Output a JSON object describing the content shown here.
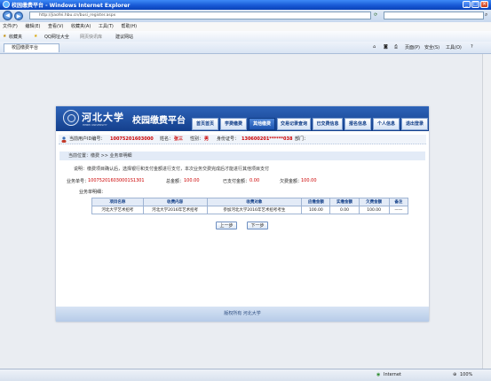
{
  "window": {
    "title": "校园缴费平台 - Windows Internet Explorer",
    "minimize": "_",
    "maximize": "□",
    "close": "×"
  },
  "address": {
    "url": "http://jiaofei.hbu.cn/busi_register.aspx",
    "back": "◀",
    "forward": "▶"
  },
  "menu": [
    "文件(F)",
    "编辑(E)",
    "查看(V)",
    "收藏夹(A)",
    "工具(T)",
    "帮助(H)"
  ],
  "favorites": {
    "label": "收藏夹",
    "items": [
      "QQ网址大全",
      "网页快讯库",
      "建议网站"
    ]
  },
  "tab": {
    "label": "校园缴费平台"
  },
  "toolbar_right": [
    "页面(P)",
    "安全(S)",
    "工具(O)",
    "?"
  ],
  "portal": {
    "logo_calligraphy": "河北大学",
    "logo_en": "HEBEI UNIVERSITY",
    "site_title": "校园缴费平台",
    "nav": [
      "首页首页",
      "学费缴费",
      "其他缴费",
      "交易记录查询",
      "已交费信息",
      "报名信息",
      "个人信息",
      "退出登录"
    ],
    "active_nav": 2,
    "user": {
      "id_label": "当前用户ID编号：",
      "id_value": "10075201603000",
      "name_label": "姓名：",
      "name_value": "张三",
      "gender_label": "性别：",
      "gender_value": "男",
      "idcard_label": "身份证号：",
      "idcard_value": "130600201******038",
      "dept_label": "部门："
    },
    "breadcrumb": "当前位置：缴费 >> 业务单明细",
    "note": "说明：缴费项目确认后，选择银行和支付金额进行支付，本次业务交费完成后才能进行其他项目支付",
    "summary": {
      "order_label": "业务单号：",
      "order_value": "100752016030001S1301",
      "total_label": "总金额：",
      "total_value": "100.00",
      "paid_label": "已支付金额：",
      "paid_value": "0.00",
      "owed_label": "欠费金额：",
      "owed_value": "100.00"
    },
    "detail_label": "业务单明细：",
    "table": {
      "headers": [
        "项目名称",
        "收费内容",
        "收费对象",
        "应缴金额",
        "实缴金额",
        "欠费金额",
        "备注"
      ],
      "rows": [
        [
          "河北大学艺术招考",
          "河北大学2016年艺术招考",
          "参加河北大学2016年艺术招考考生",
          "100.00",
          "0.00",
          "100.00",
          "——"
        ]
      ]
    },
    "prev_button": "上一步",
    "next_button": "下一步",
    "footer": "版权所有 河北大学"
  },
  "status": {
    "zone": "Internet",
    "zoom": "100%"
  }
}
